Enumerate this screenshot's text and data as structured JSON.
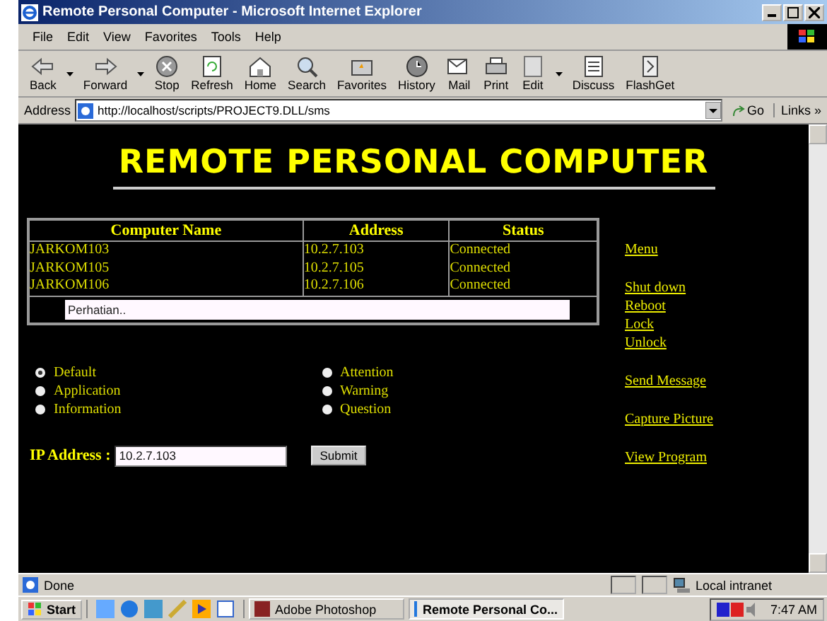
{
  "window": {
    "title": "Remote Personal Computer - Microsoft Internet Explorer"
  },
  "menu": [
    "File",
    "Edit",
    "View",
    "Favorites",
    "Tools",
    "Help"
  ],
  "toolbar": [
    {
      "label": "Back",
      "kind": "back",
      "dropdown": true
    },
    {
      "label": "Forward",
      "kind": "forward",
      "dropdown": true
    },
    {
      "label": "Stop",
      "kind": "stop",
      "dropdown": false
    },
    {
      "label": "Refresh",
      "kind": "refresh",
      "dropdown": false
    },
    {
      "label": "Home",
      "kind": "home",
      "dropdown": false
    },
    {
      "label": "Search",
      "kind": "search",
      "dropdown": false
    },
    {
      "label": "Favorites",
      "kind": "favorites",
      "dropdown": false
    },
    {
      "label": "History",
      "kind": "history",
      "dropdown": false
    },
    {
      "label": "Mail",
      "kind": "mail",
      "dropdown": false
    },
    {
      "label": "Print",
      "kind": "print",
      "dropdown": false
    },
    {
      "label": "Edit",
      "kind": "edit",
      "dropdown": true
    },
    {
      "label": "Discuss",
      "kind": "discuss",
      "dropdown": false
    },
    {
      "label": "FlashGet",
      "kind": "flashget",
      "dropdown": false
    }
  ],
  "address": {
    "label": "Address",
    "value": "http://localhost/scripts/PROJECT9.DLL/sms",
    "go": "Go",
    "links": "Links »"
  },
  "page": {
    "heading": "REMOTE PERSONAL COMPUTER",
    "table": {
      "columns": [
        "Computer Name",
        "Address",
        "Status"
      ],
      "rows": [
        [
          "JARKOM103",
          "10.2.7.103",
          "Connected"
        ],
        [
          "JARKOM105",
          "10.2.7.105",
          "Connected"
        ],
        [
          "JARKOM106",
          "10.2.7.106",
          "Connected"
        ]
      ],
      "notice": "Perhatian.."
    },
    "message_types": [
      {
        "label": "Default",
        "selected": true
      },
      {
        "label": "Application",
        "selected": false
      },
      {
        "label": "Information",
        "selected": false
      },
      {
        "label": "Attention",
        "selected": false
      },
      {
        "label": "Warning",
        "selected": false
      },
      {
        "label": "Question",
        "selected": false
      }
    ],
    "ip_label": "IP Address :",
    "ip_value": "10.2.7.103",
    "submit": "Submit",
    "link_groups": [
      [
        "Menu"
      ],
      [
        "Shut down",
        "Reboot",
        "Lock",
        "Unlock"
      ],
      [
        "Send Message"
      ],
      [
        "Capture Picture"
      ],
      [
        "View Program"
      ]
    ]
  },
  "status_bar": {
    "text": "Done",
    "zone": "Local intranet"
  },
  "taskbar": {
    "start": "Start",
    "tasks": [
      {
        "label": "Adobe Photoshop",
        "selected": false
      },
      {
        "label": "Remote Personal Co...",
        "selected": true
      }
    ],
    "clock": "7:47 AM"
  }
}
